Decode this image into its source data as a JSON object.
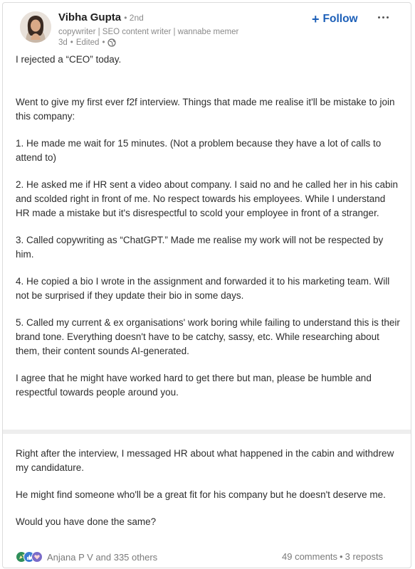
{
  "author": {
    "name": "Vibha Gupta",
    "degree": "• 2nd",
    "headline": "copywriter | SEO content writer | wannabe memer",
    "time": "3d",
    "edited": "Edited",
    "visibility_icon": "globe-icon"
  },
  "actions": {
    "follow_label": "Follow",
    "follow_icon": "plus-icon",
    "more_icon": "more-dots-icon"
  },
  "post": {
    "paragraphs": [
      "I rejected a “CEO” today.",
      "Went to give my first ever f2f interview. Things that made me realise it'll be mistake to join this company:",
      "1. He made me wait for 15 minutes. (Not a problem because they have a lot of calls to attend to)",
      "2. He asked me if HR sent a video about company. I said no and he called her in his cabin and scolded right in front of me. No respect towards his employees. While I understand HR made a mistake but it's disrespectful to scold your employee in front of a stranger.",
      "3. Called copywriting as “ChatGPT.” Made me realise my work will not be respected by him.",
      "4. He copied a bio I wrote in the assignment and forwarded it to his marketing team. Will not be surprised if they update their bio in some days.",
      "5. Called my current & ex organisations' work boring while failing to understand this is their brand tone. Everything doesn't have to be catchy, sassy, etc. While researching about them, their content sounds AI-generated.",
      "I agree that he might have worked hard to get there but man, please be humble and respectful towards people around you.",
      "Right after the interview, I messaged HR about what happened in the cabin and withdrew my candidature.",
      "He might find someone who'll be a great fit for his company but he doesn't deserve me.",
      "Would you have done the same?"
    ]
  },
  "social": {
    "reaction_icons": [
      "celebrate-icon",
      "like-icon",
      "support-icon"
    ],
    "reactions_text": "Anjana P V and 335 others",
    "comments_text": "49 comments",
    "separator": "•",
    "reposts_text": "3 reposts"
  },
  "colors": {
    "accent": "#1c5fb8",
    "muted_text": "#8a8a8a",
    "body_text": "#2d2d2d",
    "divider": "#eeeeee"
  }
}
